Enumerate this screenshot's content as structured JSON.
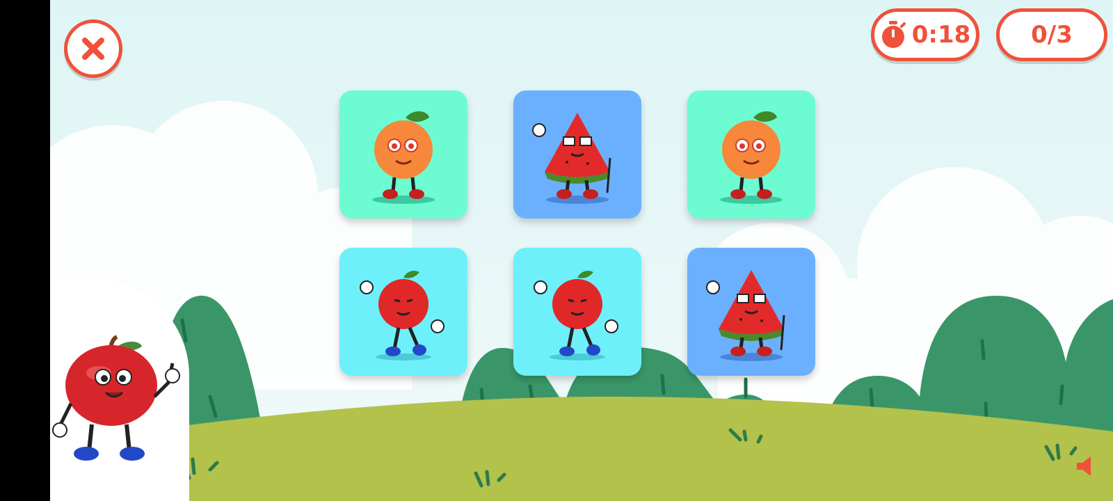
{
  "game": {
    "timer": "0:18",
    "score": "0/3"
  },
  "icons": {
    "close": "close-icon",
    "timer": "stopwatch-icon",
    "sound": "speaker-icon"
  },
  "colors": {
    "accent": "#f0513a",
    "card_mint": "#6dfcd2",
    "card_blue": "#6bb0ff",
    "card_cyan": "#6ef0fb",
    "grass": "#b2c24b",
    "bush": "#3a9669"
  },
  "cards": [
    {
      "fruit": "peach",
      "color": "#6dfcd2"
    },
    {
      "fruit": "watermelon",
      "color": "#6bb0ff"
    },
    {
      "fruit": "peach",
      "color": "#6dfcd2"
    },
    {
      "fruit": "apple",
      "color": "#6ef0fb"
    },
    {
      "fruit": "apple",
      "color": "#6ef0fb"
    },
    {
      "fruit": "watermelon",
      "color": "#6bb0ff"
    }
  ],
  "mascot": "apple-mascot"
}
